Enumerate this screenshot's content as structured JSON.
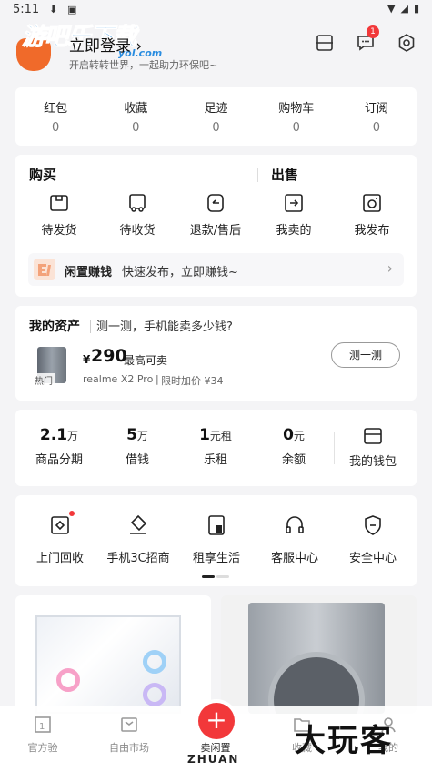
{
  "status_bar": {
    "time": "5:11"
  },
  "watermark": {
    "title": "游吧乐下载",
    "sub": "yol.com"
  },
  "header": {
    "login_label": "立即登录 ›",
    "subtitle": "开启转转世界，一起助力环保吧~",
    "message_badge": "1"
  },
  "stats": [
    {
      "label": "红包",
      "value": "0"
    },
    {
      "label": "收藏",
      "value": "0"
    },
    {
      "label": "足迹",
      "value": "0"
    },
    {
      "label": "购物车",
      "value": "0"
    },
    {
      "label": "订阅",
      "value": "0"
    }
  ],
  "trade": {
    "buy_title": "购买",
    "sell_title": "出售",
    "actions": [
      {
        "label": "待发货",
        "icon": "box-icon"
      },
      {
        "label": "待收货",
        "icon": "truck-icon"
      },
      {
        "label": "退款/售后",
        "icon": "return-icon"
      },
      {
        "label": "我卖的",
        "icon": "export-icon"
      },
      {
        "label": "我发布",
        "icon": "camera-icon"
      }
    ],
    "promo_title": "闲置赚钱",
    "promo_text": "快速发布，立即赚钱~",
    "promo_arrow": "›"
  },
  "assets": {
    "title": "我的资产",
    "question": "测一测，手机能卖多少钱?",
    "price_symbol": "¥",
    "price": "290",
    "price_note": "最高可卖",
    "phone_tag": "热门",
    "phone_model": "realme X2 Pro",
    "extra": "限时加价 ¥34",
    "button": "测一测"
  },
  "wallet": [
    {
      "num": "2.1",
      "unit": "万",
      "label": "商品分期"
    },
    {
      "num": "5",
      "unit": "万",
      "label": "借钱"
    },
    {
      "num": "1",
      "unit": "元租",
      "label": "乐租"
    },
    {
      "num": "0",
      "unit": "元",
      "label": "余额"
    },
    {
      "num": "",
      "unit": "",
      "label": "我的钱包"
    }
  ],
  "services": [
    {
      "label": "上门回收",
      "icon": "recycle-icon"
    },
    {
      "label": "手机3C招商",
      "icon": "tag-icon"
    },
    {
      "label": "租享生活",
      "icon": "rent-icon"
    },
    {
      "label": "客服中心",
      "icon": "headset-icon"
    },
    {
      "label": "安全中心",
      "icon": "shield-icon"
    }
  ],
  "bottom_nav": [
    {
      "label": "官方验"
    },
    {
      "label": "自由市场"
    },
    {
      "label": "卖闲置"
    },
    {
      "label": "收藏"
    },
    {
      "label": "我的"
    }
  ],
  "brand_text": "ZHUAN",
  "corner_watermark": "大玩客",
  "colors": {
    "accent": "#f2383a",
    "background": "#f4f4f6"
  }
}
